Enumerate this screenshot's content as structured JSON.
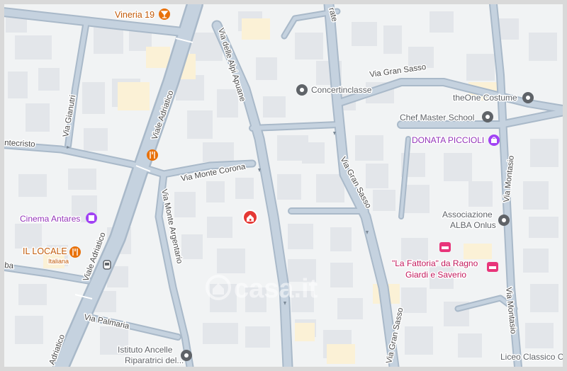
{
  "map": {
    "colors": {
      "land": "#f1f3f4",
      "building": "#e3e6ea",
      "road_casing": "#a9b9c9",
      "road_fill": "#bccad8",
      "gray_poi": "#5f6368",
      "orange_poi": "#e8710a",
      "purple_poi": "#a142f4",
      "pink_poi": "#e8357a",
      "red_marker": "#e53935"
    },
    "streets": {
      "viale_adriatico_upper": "Viale Adriatico",
      "viale_adriatico_mid": "Viale Adriatico",
      "viale_adriatico_lower": "Adriatico",
      "via_delle_alpi_apuane": "Via delle Alpi Apuane",
      "via_monte_corona": "Via Monte Corona",
      "via_monte_argentario": "Via Monte Argentario",
      "via_gianoutri": "Via Gianutri",
      "via_montecristo": "ntecristo",
      "via_palmaria": "Via Palmaria",
      "via_gran_sasso_top": "Via Gran Sasso",
      "via_gran_sasso_mid": "Via Gran Sasso",
      "via_gran_sasso_bottom": "Via Gran Sasso",
      "via_montasio_upper": "Via Montasio",
      "via_montasio_lower": "Via Montasio",
      "via_top_fragment": "rate",
      "via_left_fragment": "ba"
    },
    "places": {
      "vineria": "Vineria 19",
      "concertinclasse": "Concertinclasse",
      "theone": "theOne Costume",
      "chef": "Chef Master School",
      "donata": "DONATA PICCIOLI",
      "cinema": "Cinema Antares",
      "il_locale": "IL LOCALE",
      "il_locale_sub": "Italiana",
      "associazione_1": "Associazione",
      "associazione_2": "ALBA Onlus",
      "fattoria_1": "\"La Fattoria\" da Ragno",
      "fattoria_2": "Giardi e Saverio",
      "istituto_1": "Istituto Ancelle",
      "istituto_2": "Riparatrici del...",
      "liceo": "Liceo Classico Ci"
    },
    "watermark": "casa.it",
    "icons": [
      "restaurant-icon",
      "place-pin-icon",
      "theater-icon",
      "hotel-icon",
      "shopping-bag-icon",
      "transit-icon",
      "property-marker-icon"
    ]
  }
}
